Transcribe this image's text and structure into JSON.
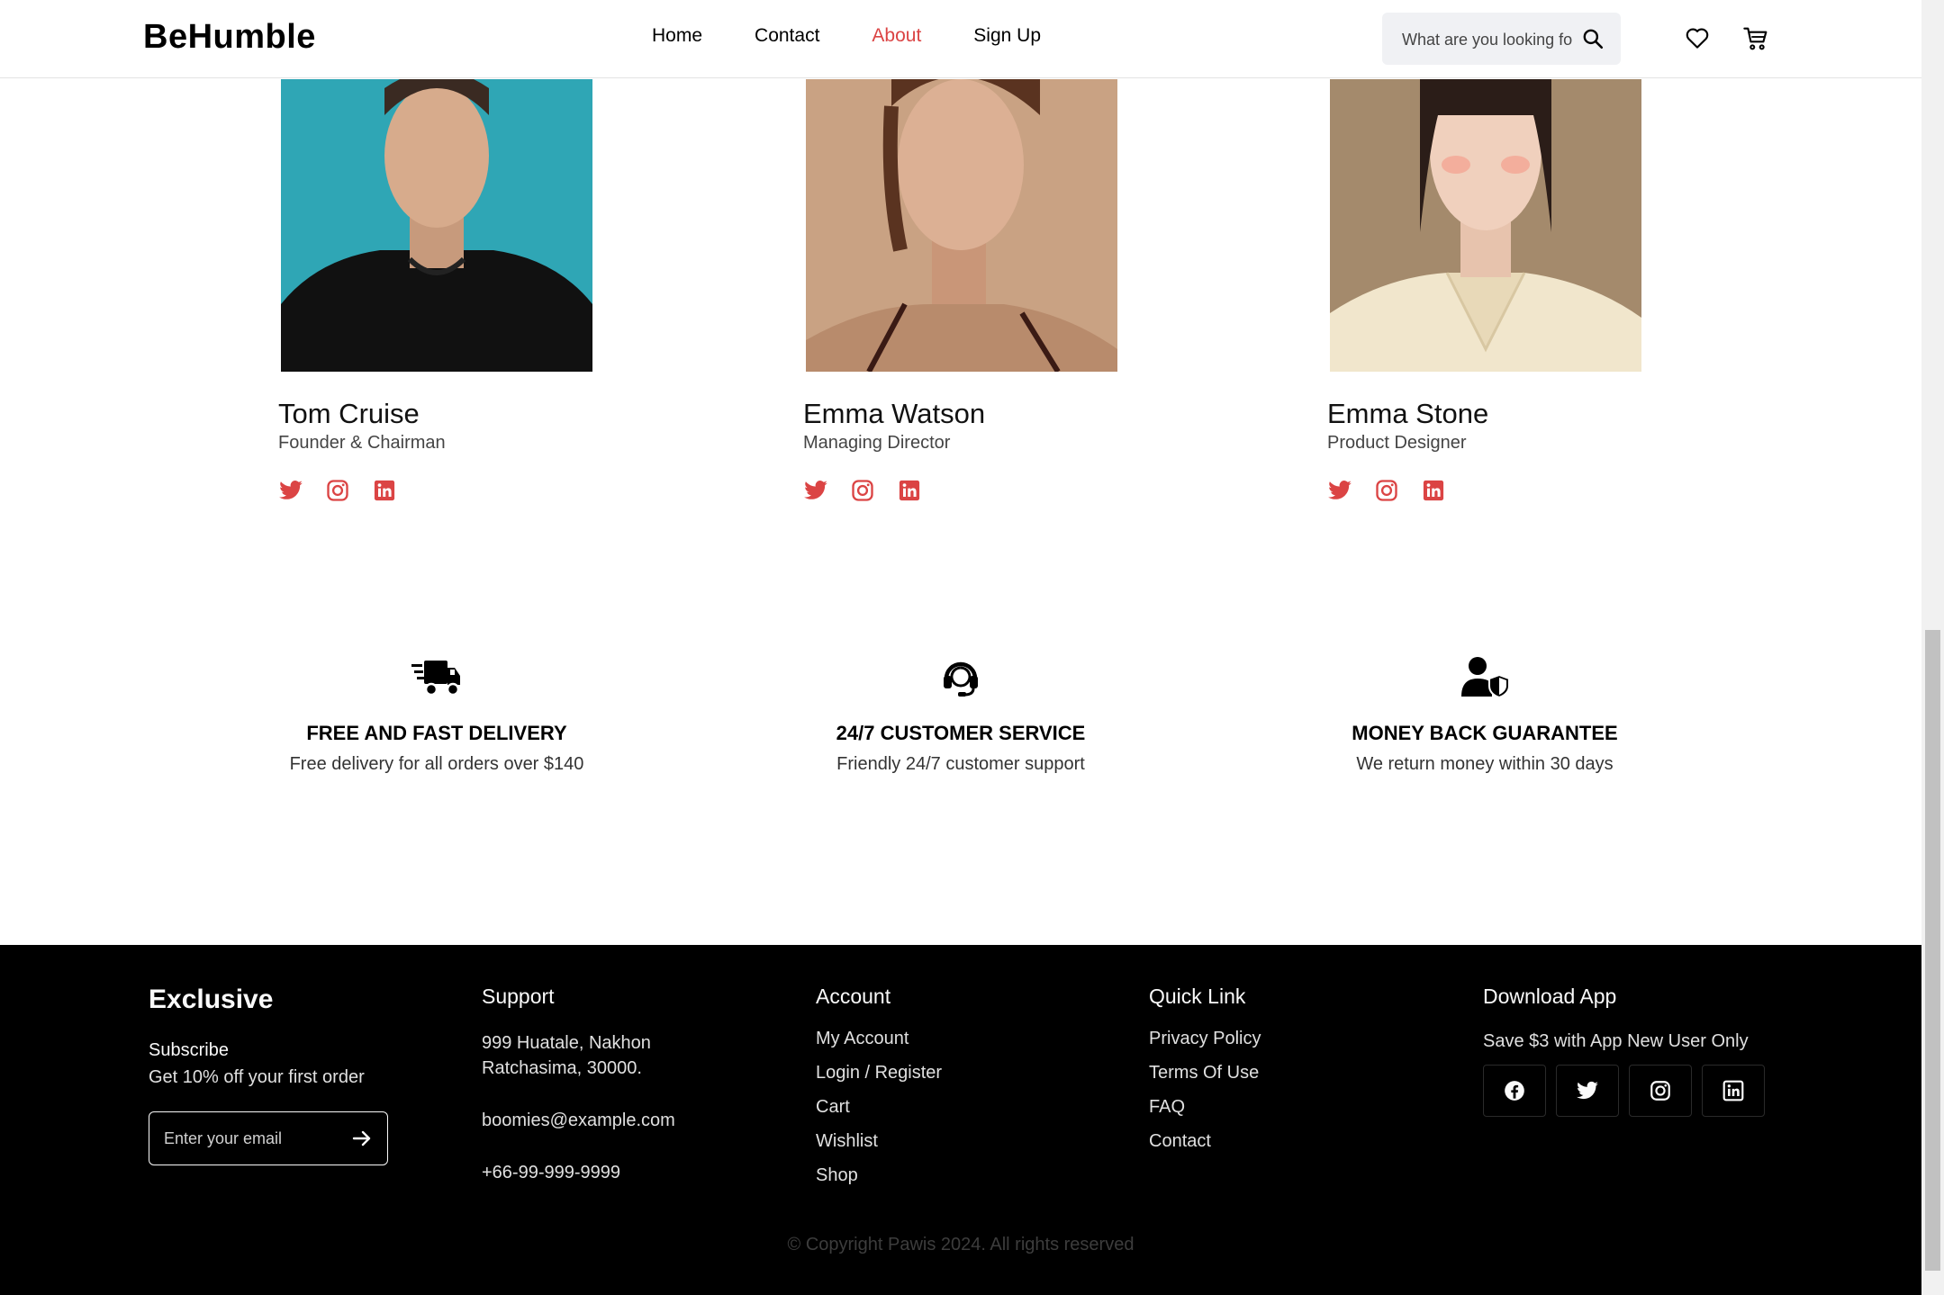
{
  "header": {
    "logo": "BeHumble",
    "nav": [
      "Home",
      "Contact",
      "About",
      "Sign Up"
    ],
    "active_nav": "About",
    "search_placeholder": "What are you looking for?",
    "icons": [
      "search-icon",
      "heart-icon",
      "cart-icon"
    ]
  },
  "team": [
    {
      "name": "Tom Cruise",
      "role": "Founder & Chairman"
    },
    {
      "name": "Emma Watson",
      "role": "Managing Director"
    },
    {
      "name": "Emma Stone",
      "role": "Product Designer"
    }
  ],
  "member_socials": [
    "twitter-icon",
    "instagram-icon",
    "linkedin-icon"
  ],
  "services": [
    {
      "icon": "delivery-truck-icon",
      "title": "FREE AND FAST DELIVERY",
      "desc": "Free delivery for all orders over $140"
    },
    {
      "icon": "headset-icon",
      "title": "24/7 CUSTOMER SERVICE",
      "desc": "Friendly 24/7 customer support"
    },
    {
      "icon": "user-shield-icon",
      "title": "MONEY BACK GUARANTEE",
      "desc": "We return money within 30 days"
    }
  ],
  "footer": {
    "brand": "Exclusive",
    "subscribe_title": "Subscribe",
    "subscribe_text": "Get 10% off your first order",
    "email_placeholder": "Enter your email",
    "support": {
      "title": "Support",
      "address_line1": "999 Huatale, Nakhon",
      "address_line2": "Ratchasima, 30000.",
      "email": "boomies@example.com",
      "phone": "+66-99-999-9999"
    },
    "account": {
      "title": "Account",
      "links": [
        "My Account",
        "Login / Register",
        "Cart",
        "Wishlist",
        "Shop"
      ]
    },
    "quick_link": {
      "title": "Quick Link",
      "links": [
        "Privacy Policy",
        "Terms Of Use",
        "FAQ",
        "Contact"
      ]
    },
    "download": {
      "title": "Download App",
      "text": "Save $3 with App New User Only",
      "icons": [
        "facebook-icon",
        "twitter-icon",
        "instagram-icon",
        "linkedin-icon"
      ]
    },
    "copyright": "© Copyright Pawis 2024. All rights reserved"
  },
  "colors": {
    "accent": "#db4444",
    "footer_bg": "#000000",
    "text": "#000000"
  }
}
